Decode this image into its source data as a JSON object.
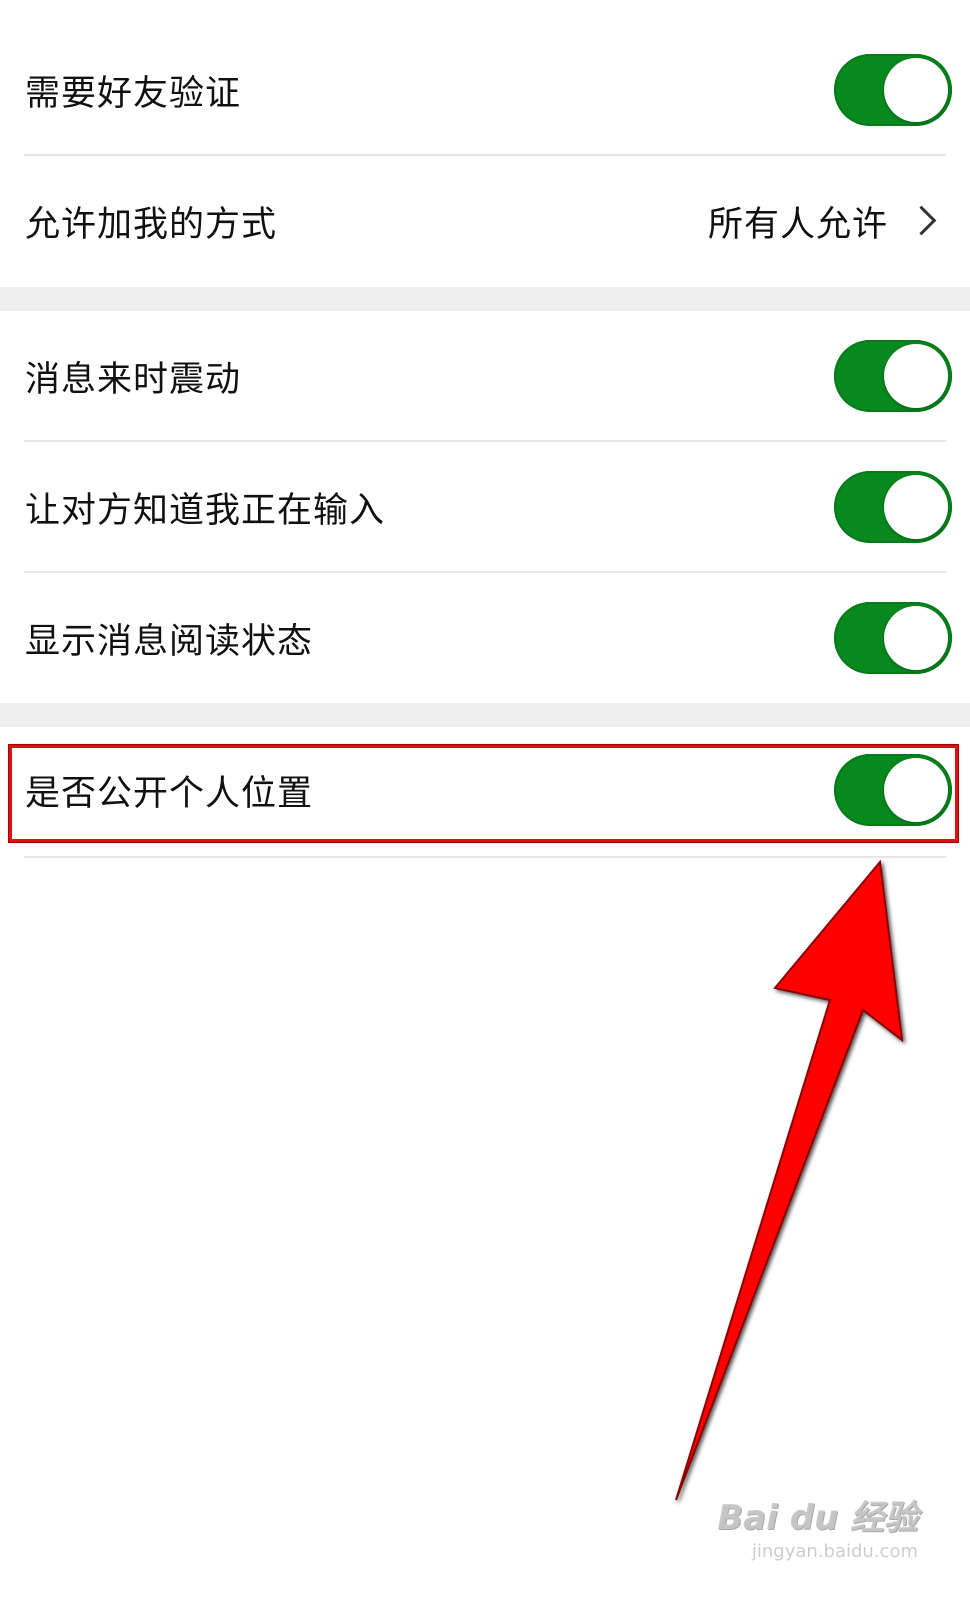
{
  "section1": {
    "friend_verification": {
      "label": "需要好友验证",
      "enabled": true
    },
    "add_methods": {
      "label": "允许加我的方式",
      "value": "所有人允许"
    }
  },
  "section2": {
    "vibrate_on_message": {
      "label": "消息来时震动",
      "enabled": true
    },
    "typing_indicator": {
      "label": "让对方知道我正在输入",
      "enabled": true
    },
    "read_status": {
      "label": "显示消息阅读状态",
      "enabled": true
    }
  },
  "section3": {
    "public_location": {
      "label": "是否公开个人位置",
      "enabled": true
    }
  },
  "annotation": {
    "highlight_color": "#e01010",
    "arrow_color": "#ff0000"
  },
  "colors": {
    "toggle_on": "#07891e",
    "section_gap": "#eeeeee"
  },
  "watermark": {
    "brand": "Bai du 经验",
    "url": "jingyan.baidu.com"
  }
}
